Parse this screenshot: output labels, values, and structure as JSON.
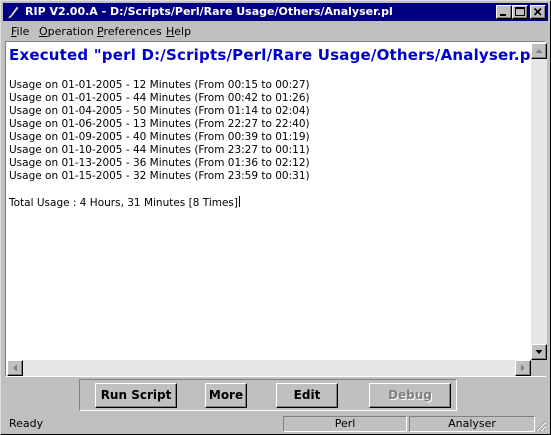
{
  "window": {
    "title": "RIP V2.00.A - D:/Scripts/Perl/Rare Usage/Others/Analyser.pl"
  },
  "menu": [
    {
      "label": "File"
    },
    {
      "label": "Operation"
    },
    {
      "label": "Preferences"
    },
    {
      "label": "Help"
    }
  ],
  "output": {
    "heading": "Executed \"perl D:/Scripts/Perl/Rare Usage/Others/Analyser.pl\"",
    "lines": [
      "Usage on 01-01-2005 - 12 Minutes (From 00:15 to 00:27)",
      "Usage on 01-01-2005 - 44 Minutes (From 00:42 to 01:26)",
      "Usage on 01-04-2005 - 50 Minutes (From 01:14 to 02:04)",
      "Usage on 01-06-2005 - 13 Minutes (From 22:27 to 22:40)",
      "Usage on 01-09-2005 - 40 Minutes (From 00:39 to 01:19)",
      "Usage on 01-10-2005 - 44 Minutes (From 23:27 to 00:11)",
      "Usage on 01-13-2005 - 36 Minutes (From 01:36 to 02:12)",
      "Usage on 01-15-2005 - 32 Minutes (From 23:59 to 00:31)"
    ],
    "total": "Total Usage : 4 Hours, 31 Minutes [8 Times]"
  },
  "buttons": {
    "run_script": "Run Script",
    "more": "More",
    "edit": "Edit",
    "debug": "Debug"
  },
  "status": {
    "state": "Ready",
    "language": "Perl",
    "script": "Analyser"
  },
  "colors": {
    "titlebar": "#000080",
    "heading": "#0000cc"
  }
}
